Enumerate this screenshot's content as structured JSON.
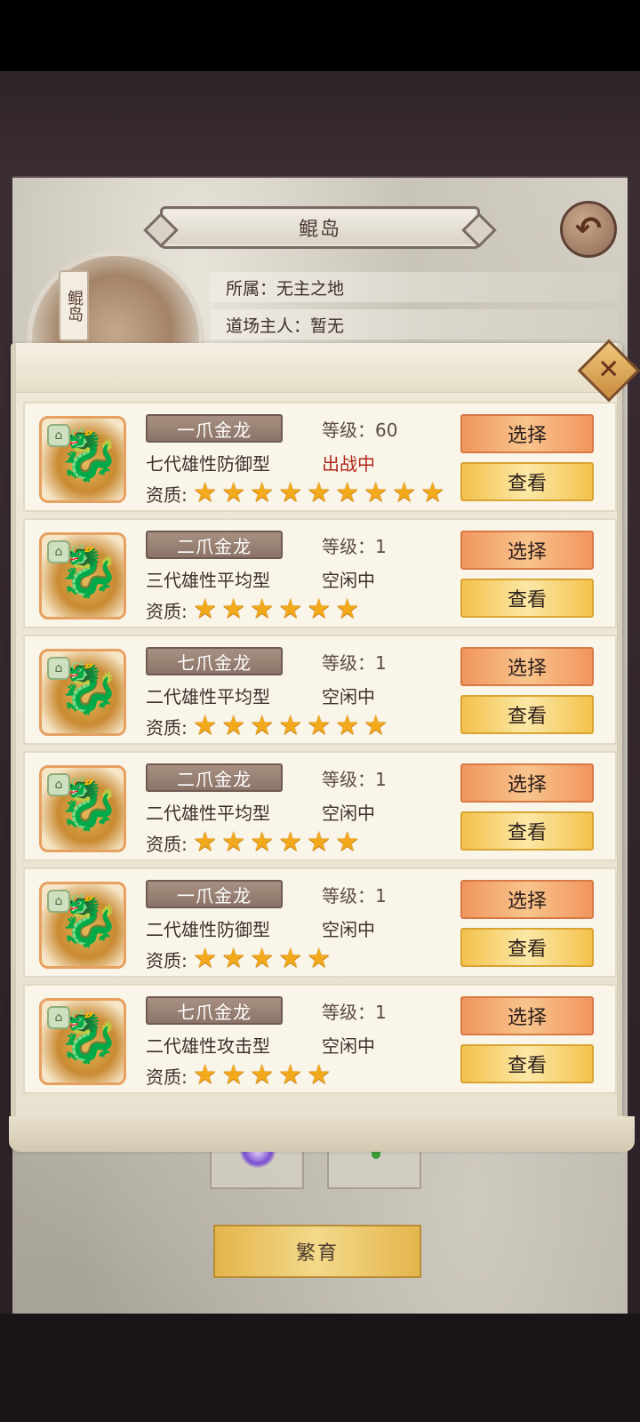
{
  "header": {
    "title": "鲲岛",
    "back_icon": "back-arrow-icon"
  },
  "island": {
    "tag": "鲲岛",
    "owner_label": "所属：无主之地",
    "master_label": "道场主人：暂无"
  },
  "dialog": {
    "close_icon": "close-icon",
    "pets": [
      {
        "name": "一爪金龙",
        "level": "等级：60",
        "desc": "七代雄性防御型",
        "status": "出战中",
        "status_active": true,
        "quality_label": "资质:",
        "stars": 9,
        "select": "选择",
        "view": "查看"
      },
      {
        "name": "二爪金龙",
        "level": "等级：1",
        "desc": "三代雄性平均型",
        "status": "空闲中",
        "status_active": false,
        "quality_label": "资质:",
        "stars": 6,
        "select": "选择",
        "view": "查看"
      },
      {
        "name": "七爪金龙",
        "level": "等级：1",
        "desc": "二代雄性平均型",
        "status": "空闲中",
        "status_active": false,
        "quality_label": "资质:",
        "stars": 7,
        "select": "选择",
        "view": "查看"
      },
      {
        "name": "二爪金龙",
        "level": "等级：1",
        "desc": "二代雄性平均型",
        "status": "空闲中",
        "status_active": false,
        "quality_label": "资质:",
        "stars": 6,
        "select": "选择",
        "view": "查看"
      },
      {
        "name": "一爪金龙",
        "level": "等级：1",
        "desc": "二代雄性防御型",
        "status": "空闲中",
        "status_active": false,
        "quality_label": "资质:",
        "stars": 5,
        "select": "选择",
        "view": "查看"
      },
      {
        "name": "七爪金龙",
        "level": "等级：1",
        "desc": "二代雄性攻击型",
        "status": "空闲中",
        "status_active": false,
        "quality_label": "资质:",
        "stars": 5,
        "select": "选择",
        "view": "查看"
      }
    ]
  },
  "footer": {
    "breed_label": "繁育"
  },
  "colors": {
    "status_active": "#b0281c",
    "star": "#f2a91c",
    "select_button": "#f1955e",
    "view_button": "#f4c24c"
  }
}
